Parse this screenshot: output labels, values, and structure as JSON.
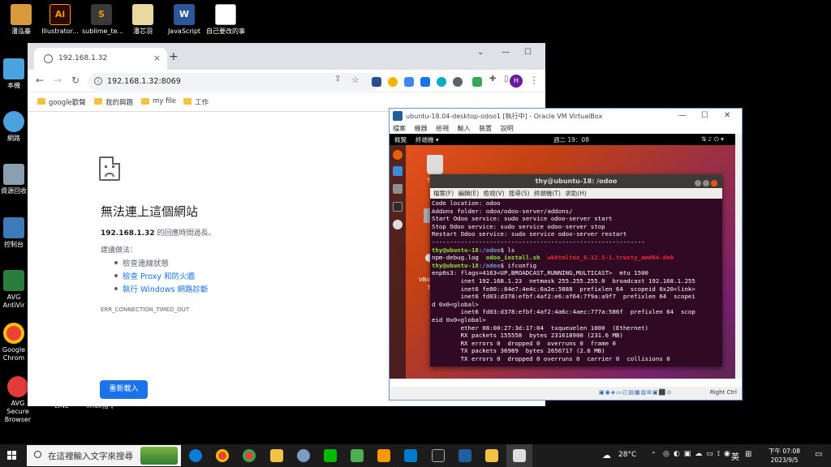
{
  "desktop": {
    "icons": [
      {
        "label": "潘泓蓁",
        "color": "#d79a3c"
      },
      {
        "label": "Illustrator...",
        "glyph": "Ai",
        "color": "#2b0a00"
      },
      {
        "label": "sublime_te...",
        "color": "#3a3a3a"
      },
      {
        "label": "潘芯羽",
        "color": "#e8d9a0"
      },
      {
        "label": "JavaScript講義_01.doc",
        "glyph": "W",
        "color": "#2b579a"
      },
      {
        "label": "自己要改的事項.txt",
        "color": "#ffffff"
      },
      {
        "label": "本機",
        "color": "#4aa3df"
      },
      {
        "label": "網路",
        "color": "#4aa3df"
      },
      {
        "label": "資源回收",
        "color": "#8aa0b0"
      },
      {
        "label": "控制台",
        "color": "#3d7ab8"
      },
      {
        "label": "AVG AntiVir",
        "color": "#2a7d3a"
      },
      {
        "label": "Google Chrom",
        "color": "#ea4335"
      },
      {
        "label": "AVG Secure Browser",
        "color": "#e23b3b"
      },
      {
        "label": "LINE",
        "color": "#00b900"
      },
      {
        "label": "linux指令",
        "color": "#bbbbbb"
      }
    ]
  },
  "chrome": {
    "tab_title": "192.168.1.32",
    "tab_close": "×",
    "new_tab": "+",
    "url": "192.168.1.32:8069",
    "profile_initial": "H",
    "bookmarks": [
      "google歡聲",
      "我的興趣",
      "my file",
      "工作"
    ],
    "error": {
      "title": "無法連上這個網站",
      "host": "192.168.1.32",
      "desc_rest": " 的回應時間過長。",
      "suggest_heading": "建議做法：",
      "suggestions": [
        "檢查連線狀態",
        "檢查 Proxy 和防火牆",
        "執行 Windows 網路診斷"
      ],
      "code": "ERR_CONNECTION_TIMED_OUT",
      "reload": "重新載入"
    }
  },
  "vbox": {
    "title": "ubuntu-18.04-desktop-odoo1 [執行中] - Oracle VM VirtualBox",
    "menu": [
      "檔案",
      "機器",
      "檢視",
      "輸入",
      "裝置",
      "說明"
    ],
    "status_right": "Right Ctrl",
    "ubuntu": {
      "activities": "概覽",
      "app": "終端機 ▾",
      "clock": "週二 19：08",
      "desktop_label": "VBo",
      "desktop_label2": "7"
    },
    "terminal": {
      "title": "thy@ubuntu-18: /odoo",
      "menu": [
        "檔案(F)",
        "編輯(E)",
        "檢視(V)",
        "搜尋(S)",
        "終端機(T)",
        "求助(H)"
      ],
      "lines": [
        "Code location: odoo",
        "Addons folder: odoo/odoo-server/addons/",
        "Start Odoo service: sudo service odoo-server start",
        "Stop Odoo service: sudo service odoo-server stop",
        "Restart Odoo service: sudo service odoo-server restart",
        "-----------------------------------------------------------"
      ],
      "prompt_user": "thy@ubuntu-18",
      "prompt_path": ":/odoo",
      "prompt_sign": "$ ",
      "cmd1": "ls",
      "ls_out_plain": "npm-debug.log  ",
      "ls_out_green": "odoo_install.sh",
      "ls_out_red": "wkhtmltox_0.12.5-1.trusty_amd64.deb",
      "cmd2": "ifconfig",
      "ifconfig": [
        "enp0s3: flags=4163<UP,BROADCAST,RUNNING,MULTICAST>  mtu 1500",
        "        inet 192.168.1.23  netmask 255.255.255.0  broadcast 192.168.1.255",
        "        inet6 fe80::84e7:4e4c:6a2e:5888  prefixlen 64  scopeid 0x20<link>",
        "        inet6 fd03:d378:efbf:4af2:e6:af64:7f9a:a9f7  prefixlen 64  scopei",
        "d 0x0<global>",
        "        inet6 fd03:d378:efbf:4af2:4a6c:4aec:777a:586f  prefixlen 64  scop",
        "eid 0x0<global>",
        "        ether 08:00:27:3d:17:04  txqueuelen 1000  (Ethernet)",
        "        RX packets 155558  bytes 231618900 (231.6 MB)",
        "        RX errors 0  dropped 0  overruns 0  frame 0",
        "        TX packets 36989  bytes 2656717 (2.6 MB)",
        "        TX errors 0  dropped 0 overruns 0  carrier 0  collisions 0"
      ]
    }
  },
  "taskbar": {
    "search_placeholder": "在這裡輸入文字來搜尋",
    "weather": "28°C",
    "ime": "英",
    "time": "下午 07:08",
    "date": "2023/9/5"
  }
}
